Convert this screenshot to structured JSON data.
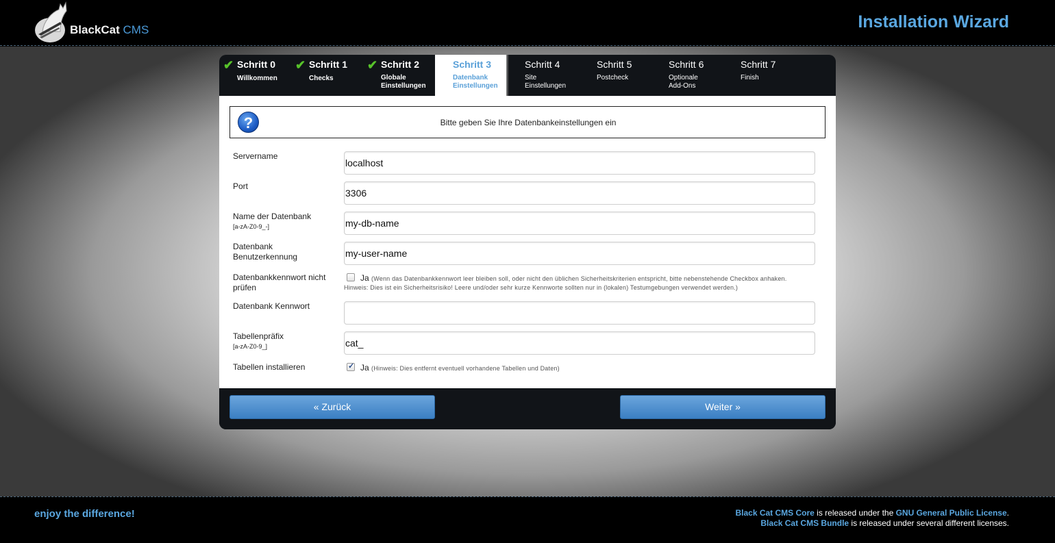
{
  "header": {
    "logo_bold": "BlackCat",
    "logo_light": "CMS",
    "title": "Installation Wizard"
  },
  "steps": [
    {
      "title": "Schritt 0",
      "sub": "Willkommen",
      "state": "done"
    },
    {
      "title": "Schritt 1",
      "sub": "Checks",
      "state": "done"
    },
    {
      "title": "Schritt 2",
      "sub": "Globale Einstellungen",
      "state": "done"
    },
    {
      "title": "Schritt 3",
      "sub": "Datenbank Einstellungen",
      "state": "active"
    },
    {
      "title": "Schritt 4",
      "sub": "Site Einstellungen",
      "state": "future"
    },
    {
      "title": "Schritt 5",
      "sub": "Postcheck",
      "state": "future"
    },
    {
      "title": "Schritt 6",
      "sub": "Optionale Add-Ons",
      "state": "future"
    },
    {
      "title": "Schritt 7",
      "sub": "Finish",
      "state": "future"
    }
  ],
  "info": {
    "icon": "question-icon",
    "text": "Bitte geben Sie Ihre Datenbankeinstellungen ein"
  },
  "form": {
    "servername": {
      "label": "Servername",
      "value": "localhost"
    },
    "port": {
      "label": "Port",
      "value": "3306"
    },
    "dbname": {
      "label": "Name der Datenbank",
      "hint": "[a-zA-Z0-9_-]",
      "value": "my-db-name"
    },
    "dbuser": {
      "label": "Datenbank Benutzerkennung",
      "value": "my-user-name"
    },
    "nocheck": {
      "label": "Datenbankkennwort nicht prüfen",
      "checked": false,
      "ja": "Ja",
      "note1": "(Wenn das Datenbankkennwort leer bleiben soll, oder nicht den üblichen Sicherheitskriterien entspricht, bitte nebenstehende Checkbox anhaken.",
      "note2": "Hinweis: Dies ist ein Sicherheitsrisiko! Leere und/oder sehr kurze Kennworte sollten nur in (lokalen) Testumgebungen verwendet werden.)"
    },
    "dbpass": {
      "label": "Datenbank Kennwort",
      "value": ""
    },
    "prefix": {
      "label": "Tabellenpräfix",
      "hint": "[a-zA-Z0-9_]",
      "value": "cat_"
    },
    "install": {
      "label": "Tabellen installieren",
      "checked": true,
      "ja": "Ja",
      "note": "(Hinweis: Dies entfernt eventuell vorhandene Tabellen und Daten)"
    }
  },
  "buttons": {
    "back": "« Zurück",
    "next": "Weiter »"
  },
  "footer": {
    "slogan": "enjoy the difference!",
    "core_link": "Black Cat CMS Core",
    "core_text": " is released under the ",
    "gpl_link": "GNU General Public License",
    "period": ".",
    "bundle_link": "Black Cat CMS Bundle",
    "bundle_text": " is released under several different licenses."
  },
  "colors": {
    "accent": "#5aa7e0",
    "check": "#57c22a",
    "button": "#4a8ccc"
  }
}
